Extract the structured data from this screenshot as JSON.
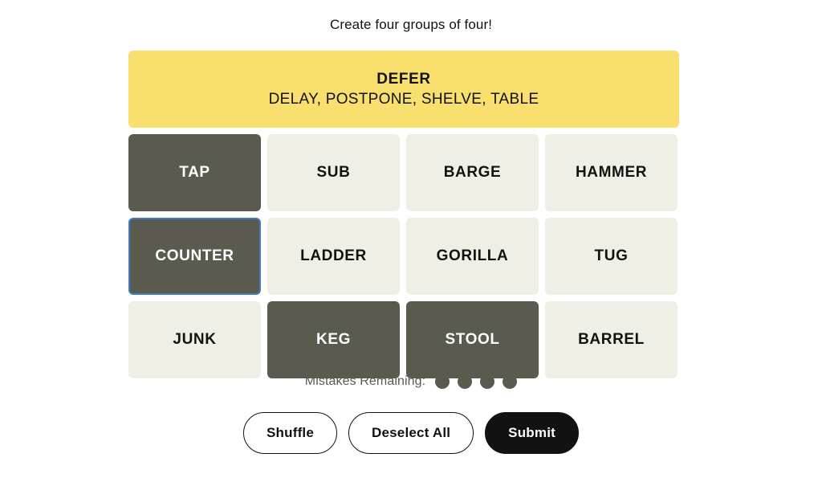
{
  "page": {
    "title": "Create four groups of four!"
  },
  "colors": {
    "solved_yellow": "#f9df6d",
    "tile_unselected_bg": "#efefe6",
    "tile_selected_bg": "#5a5a4e",
    "focus_ring": "#3e7cc4",
    "text_dark": "#121212",
    "submit_bg": "#121212",
    "mistake_dot": "#5a5a4e"
  },
  "board": {
    "solved_groups": [
      {
        "title": "DEFER",
        "members": "DELAY, POSTPONE, SHELVE, TABLE",
        "color": "#f9df6d"
      }
    ],
    "tiles": [
      {
        "label": "TAP",
        "selected": true,
        "focused": false
      },
      {
        "label": "SUB",
        "selected": false,
        "focused": false
      },
      {
        "label": "BARGE",
        "selected": false,
        "focused": false
      },
      {
        "label": "HAMMER",
        "selected": false,
        "focused": false
      },
      {
        "label": "COUNTER",
        "selected": true,
        "focused": true
      },
      {
        "label": "LADDER",
        "selected": false,
        "focused": false
      },
      {
        "label": "GORILLA",
        "selected": false,
        "focused": false
      },
      {
        "label": "TUG",
        "selected": false,
        "focused": false
      },
      {
        "label": "JUNK",
        "selected": false,
        "focused": false
      },
      {
        "label": "KEG",
        "selected": true,
        "focused": false
      },
      {
        "label": "STOOL",
        "selected": true,
        "focused": false
      },
      {
        "label": "BARREL",
        "selected": false,
        "focused": false
      }
    ]
  },
  "mistakes": {
    "label": "Mistakes Remaining:",
    "remaining": 4
  },
  "actions": {
    "shuffle_label": "Shuffle",
    "deselect_label": "Deselect All",
    "submit_label": "Submit"
  }
}
